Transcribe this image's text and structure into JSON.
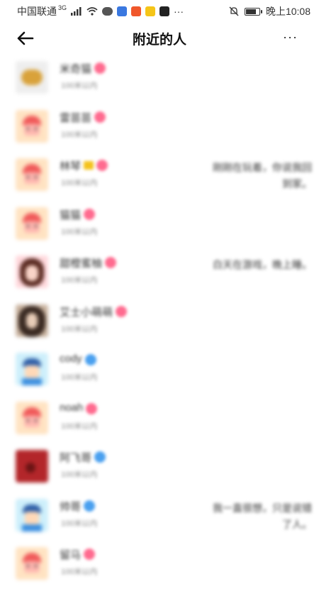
{
  "status_bar": {
    "carrier": "中国联通",
    "network": "3G",
    "time": "晚上10:08",
    "more": "···"
  },
  "header": {
    "title": "附近的人",
    "more": "···"
  },
  "people": [
    {
      "name": "米奇猫",
      "distance": "100米以内",
      "avatar": "cat-avatar",
      "gender": "female",
      "signature": ""
    },
    {
      "name": "雷苗苗",
      "distance": "100米以内",
      "avatar": "child-avatar",
      "gender": "female",
      "signature": ""
    },
    {
      "name": "林琴",
      "distance": "100米以内",
      "avatar": "child-avatar",
      "gender": "female",
      "crown": true,
      "signature": "刚刚在玩着，你说我回到家。"
    },
    {
      "name": "猫猫",
      "distance": "100米以内",
      "avatar": "child-avatar",
      "gender": "female",
      "signature": ""
    },
    {
      "name": "甜橙蜜柚",
      "distance": "100米以内",
      "avatar": "girl-avatar",
      "gender": "female",
      "signature": "白天在游戏，晚上睡。"
    },
    {
      "name": "艾士小萌萌",
      "distance": "100米以内",
      "avatar": "photo-avatar",
      "gender": "female",
      "signature": ""
    },
    {
      "name": "cody",
      "distance": "100米以内",
      "avatar": "boy-avatar",
      "gender": "male",
      "signature": ""
    },
    {
      "name": "noah",
      "distance": "100米以内",
      "avatar": "child-avatar",
      "gender": "female",
      "signature": ""
    },
    {
      "name": "阿飞哥",
      "distance": "100米以内",
      "avatar": "red-avatar",
      "gender": "male",
      "signature": ""
    },
    {
      "name": "帅哥",
      "distance": "100米以内",
      "avatar": "boy-avatar",
      "gender": "male",
      "signature": "我一直很想，只是说错了人。"
    },
    {
      "name": "留马",
      "distance": "100米以内",
      "avatar": "child-avatar",
      "gender": "female",
      "signature": ""
    }
  ]
}
